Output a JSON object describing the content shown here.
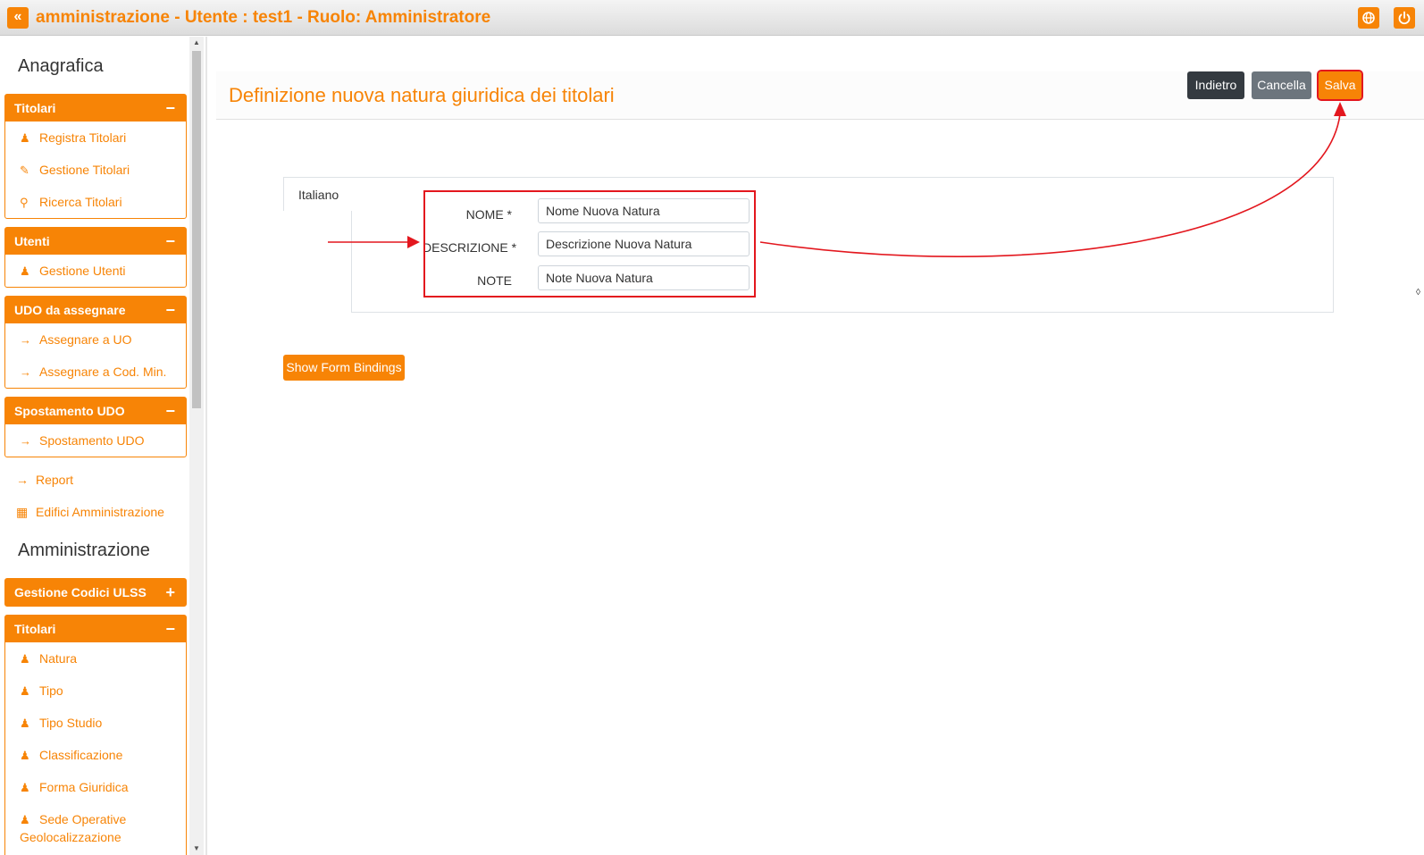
{
  "header": {
    "back_glyph": "«",
    "title": "amministrazione - Utente : test1 - Ruolo: Amministratore",
    "globe_icon": "globe-icon",
    "power_icon": "power-icon"
  },
  "sidebar": {
    "section_anagrafica": "Anagrafica",
    "titolari": {
      "title": "Titolari",
      "toggle": "−",
      "items": [
        {
          "label": "Registra Titolari",
          "icon": "user-edit-icon"
        },
        {
          "label": "Gestione Titolari",
          "icon": "edit-icon"
        },
        {
          "label": "Ricerca Titolari",
          "icon": "search-icon"
        }
      ]
    },
    "utenti": {
      "title": "Utenti",
      "toggle": "−",
      "items": [
        {
          "label": "Gestione Utenti",
          "icon": "user-edit-icon"
        }
      ]
    },
    "udo_assegnare": {
      "title": "UDO da assegnare",
      "toggle": "−",
      "items": [
        {
          "label": "Assegnare a UO",
          "icon": "arrow-right-icon"
        },
        {
          "label": "Assegnare a Cod. Min.",
          "icon": "arrow-right-icon"
        }
      ]
    },
    "spostamento": {
      "title": "Spostamento UDO",
      "toggle": "−",
      "items": [
        {
          "label": "Spostamento UDO",
          "icon": "arrow-right-icon"
        }
      ]
    },
    "report": "Report",
    "edifici": "Edifici Amministrazione",
    "section_amministrazione": "Amministrazione",
    "codici_ulss": {
      "title": "Gestione Codici ULSS",
      "toggle": "+"
    },
    "titolari2": {
      "title": "Titolari",
      "toggle": "−",
      "items": [
        {
          "label": "Natura",
          "icon": "user-edit-icon"
        },
        {
          "label": "Tipo",
          "icon": "user-edit-icon"
        },
        {
          "label": "Tipo Studio",
          "icon": "user-edit-icon"
        },
        {
          "label": "Classificazione",
          "icon": "user-edit-icon"
        },
        {
          "label": "Forma Giuridica",
          "icon": "user-edit-icon"
        },
        {
          "label": "Sede Operative",
          "icon": "user-edit-icon"
        }
      ],
      "overflow_text": "Geolocalizzazione"
    }
  },
  "main": {
    "page_title": "Definizione nuova natura giuridica dei titolari",
    "buttons": {
      "back": "Indietro",
      "cancel": "Cancella",
      "save": "Salva"
    },
    "language_tab": "Italiano",
    "form": {
      "nome_label": "NOME *",
      "nome_value": "Nome Nuova Natura",
      "descrizione_label": "DESCRIZIONE *",
      "descrizione_value": "Descrizione Nuova Natura",
      "note_label": "NOTE",
      "note_value": "Note Nuova Natura"
    },
    "bindings_button": "Show Form Bindings"
  },
  "colors": {
    "accent": "#f78406",
    "annotation": "#e3171e",
    "dark_button": "#343a40",
    "gray_button": "#6c757d"
  }
}
